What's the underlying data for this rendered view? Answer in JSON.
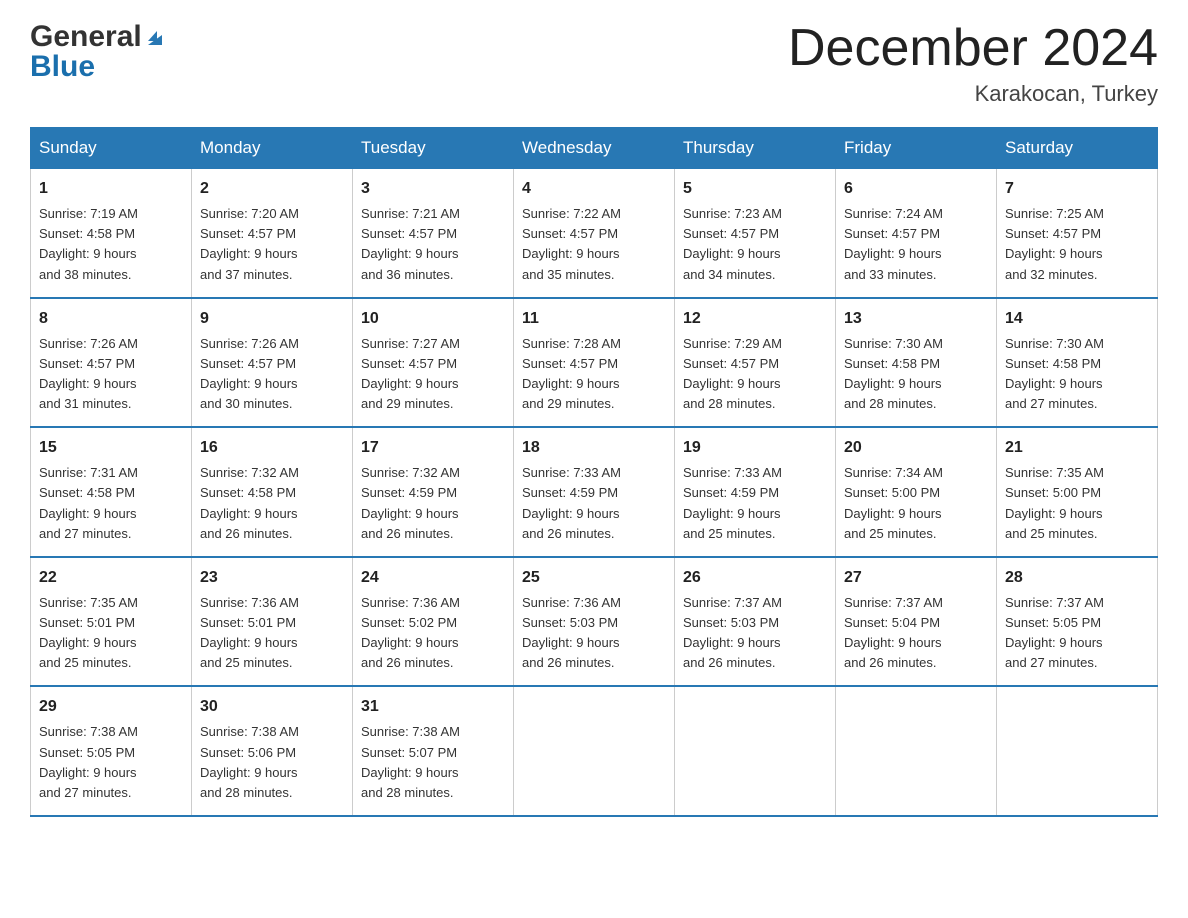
{
  "header": {
    "logo_general": "General",
    "logo_blue": "Blue",
    "month_title": "December 2024",
    "location": "Karakocan, Turkey"
  },
  "days_of_week": [
    "Sunday",
    "Monday",
    "Tuesday",
    "Wednesday",
    "Thursday",
    "Friday",
    "Saturday"
  ],
  "weeks": [
    [
      {
        "day": "1",
        "sunrise": "7:19 AM",
        "sunset": "4:58 PM",
        "daylight": "9 hours and 38 minutes."
      },
      {
        "day": "2",
        "sunrise": "7:20 AM",
        "sunset": "4:57 PM",
        "daylight": "9 hours and 37 minutes."
      },
      {
        "day": "3",
        "sunrise": "7:21 AM",
        "sunset": "4:57 PM",
        "daylight": "9 hours and 36 minutes."
      },
      {
        "day": "4",
        "sunrise": "7:22 AM",
        "sunset": "4:57 PM",
        "daylight": "9 hours and 35 minutes."
      },
      {
        "day": "5",
        "sunrise": "7:23 AM",
        "sunset": "4:57 PM",
        "daylight": "9 hours and 34 minutes."
      },
      {
        "day": "6",
        "sunrise": "7:24 AM",
        "sunset": "4:57 PM",
        "daylight": "9 hours and 33 minutes."
      },
      {
        "day": "7",
        "sunrise": "7:25 AM",
        "sunset": "4:57 PM",
        "daylight": "9 hours and 32 minutes."
      }
    ],
    [
      {
        "day": "8",
        "sunrise": "7:26 AM",
        "sunset": "4:57 PM",
        "daylight": "9 hours and 31 minutes."
      },
      {
        "day": "9",
        "sunrise": "7:26 AM",
        "sunset": "4:57 PM",
        "daylight": "9 hours and 30 minutes."
      },
      {
        "day": "10",
        "sunrise": "7:27 AM",
        "sunset": "4:57 PM",
        "daylight": "9 hours and 29 minutes."
      },
      {
        "day": "11",
        "sunrise": "7:28 AM",
        "sunset": "4:57 PM",
        "daylight": "9 hours and 29 minutes."
      },
      {
        "day": "12",
        "sunrise": "7:29 AM",
        "sunset": "4:57 PM",
        "daylight": "9 hours and 28 minutes."
      },
      {
        "day": "13",
        "sunrise": "7:30 AM",
        "sunset": "4:58 PM",
        "daylight": "9 hours and 28 minutes."
      },
      {
        "day": "14",
        "sunrise": "7:30 AM",
        "sunset": "4:58 PM",
        "daylight": "9 hours and 27 minutes."
      }
    ],
    [
      {
        "day": "15",
        "sunrise": "7:31 AM",
        "sunset": "4:58 PM",
        "daylight": "9 hours and 27 minutes."
      },
      {
        "day": "16",
        "sunrise": "7:32 AM",
        "sunset": "4:58 PM",
        "daylight": "9 hours and 26 minutes."
      },
      {
        "day": "17",
        "sunrise": "7:32 AM",
        "sunset": "4:59 PM",
        "daylight": "9 hours and 26 minutes."
      },
      {
        "day": "18",
        "sunrise": "7:33 AM",
        "sunset": "4:59 PM",
        "daylight": "9 hours and 26 minutes."
      },
      {
        "day": "19",
        "sunrise": "7:33 AM",
        "sunset": "4:59 PM",
        "daylight": "9 hours and 25 minutes."
      },
      {
        "day": "20",
        "sunrise": "7:34 AM",
        "sunset": "5:00 PM",
        "daylight": "9 hours and 25 minutes."
      },
      {
        "day": "21",
        "sunrise": "7:35 AM",
        "sunset": "5:00 PM",
        "daylight": "9 hours and 25 minutes."
      }
    ],
    [
      {
        "day": "22",
        "sunrise": "7:35 AM",
        "sunset": "5:01 PM",
        "daylight": "9 hours and 25 minutes."
      },
      {
        "day": "23",
        "sunrise": "7:36 AM",
        "sunset": "5:01 PM",
        "daylight": "9 hours and 25 minutes."
      },
      {
        "day": "24",
        "sunrise": "7:36 AM",
        "sunset": "5:02 PM",
        "daylight": "9 hours and 26 minutes."
      },
      {
        "day": "25",
        "sunrise": "7:36 AM",
        "sunset": "5:03 PM",
        "daylight": "9 hours and 26 minutes."
      },
      {
        "day": "26",
        "sunrise": "7:37 AM",
        "sunset": "5:03 PM",
        "daylight": "9 hours and 26 minutes."
      },
      {
        "day": "27",
        "sunrise": "7:37 AM",
        "sunset": "5:04 PM",
        "daylight": "9 hours and 26 minutes."
      },
      {
        "day": "28",
        "sunrise": "7:37 AM",
        "sunset": "5:05 PM",
        "daylight": "9 hours and 27 minutes."
      }
    ],
    [
      {
        "day": "29",
        "sunrise": "7:38 AM",
        "sunset": "5:05 PM",
        "daylight": "9 hours and 27 minutes."
      },
      {
        "day": "30",
        "sunrise": "7:38 AM",
        "sunset": "5:06 PM",
        "daylight": "9 hours and 28 minutes."
      },
      {
        "day": "31",
        "sunrise": "7:38 AM",
        "sunset": "5:07 PM",
        "daylight": "9 hours and 28 minutes."
      },
      null,
      null,
      null,
      null
    ]
  ],
  "labels": {
    "sunrise": "Sunrise:",
    "sunset": "Sunset:",
    "daylight": "Daylight:"
  }
}
